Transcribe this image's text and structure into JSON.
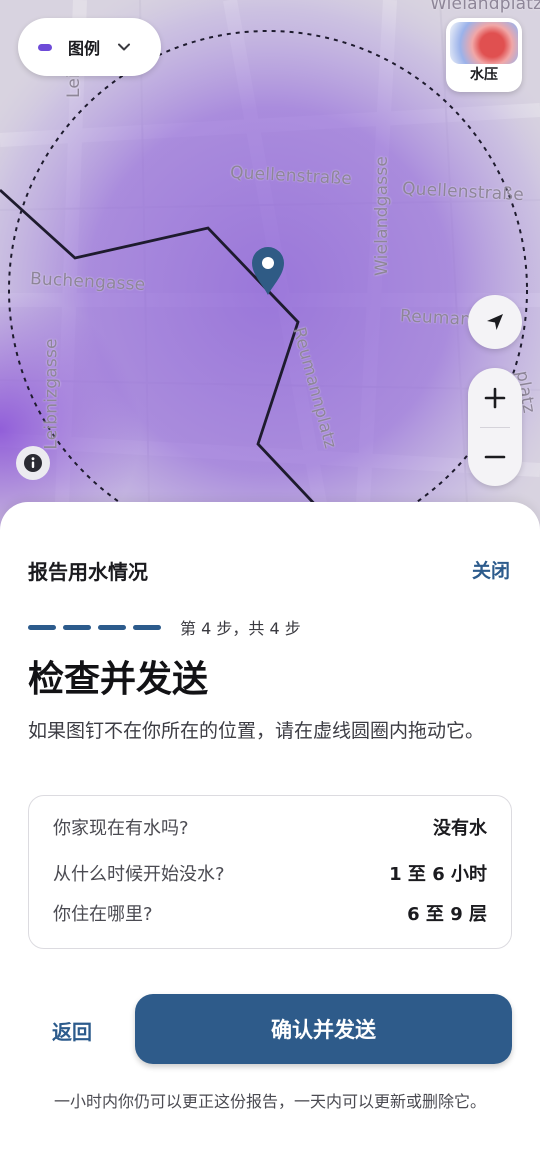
{
  "map": {
    "legend_label": "图例",
    "layer_label": "水压",
    "street_labels": {
      "wielandplatz": "Wielandplatz",
      "quellenstrasse_1": "Quellenstraße",
      "quellenstrasse_2": "Quellenstraße",
      "wielandgasse": "Wielandgasse",
      "buchengasse": "Buchengasse",
      "reumann": "Reuman",
      "reumannplatz": "Reumannplatz",
      "leibnizgasse": "Leibnizgasse",
      "leibniz_top": "Leib",
      "platz_right": "platz"
    },
    "colors": {
      "heat": "#8a5fd6",
      "pin": "#2f5b85",
      "accent": "#6e4bd8"
    }
  },
  "sheet": {
    "title": "报告用水情况",
    "close_label": "关闭",
    "step_text": "第 4 步，共 4 步",
    "step_count": 4,
    "heading": "检查并发送",
    "description": "如果图钉不在你所在的位置，请在虚线圆圈内拖动它。",
    "summary": [
      {
        "question": "你家现在有水吗?",
        "answer": "没有水"
      },
      {
        "question": "从什么时候开始没水?",
        "answer": "1 至 6 小时"
      },
      {
        "question": "你住在哪里?",
        "answer": "6 至 9 层"
      }
    ],
    "back_label": "返回",
    "confirm_label": "确认并发送",
    "footnote": "一小时内你仍可以更正这份报告，一天内可以更新或删除它。",
    "colors": {
      "primary": "#2e5b8a",
      "link": "#2c5b8c"
    }
  }
}
